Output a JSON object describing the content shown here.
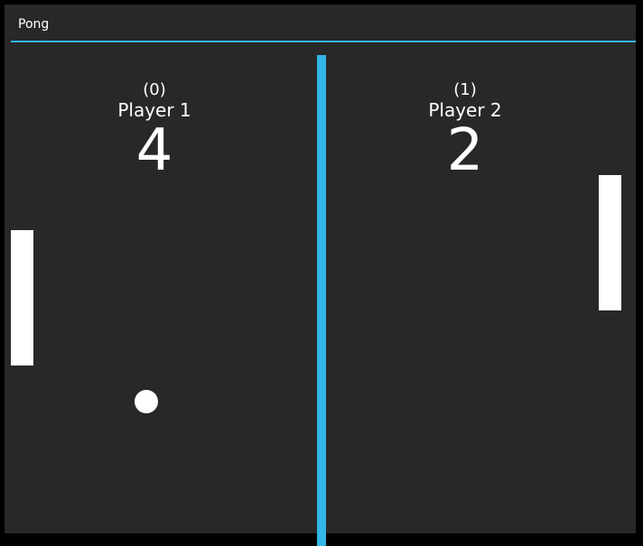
{
  "window": {
    "title": "Pong"
  },
  "players": [
    {
      "wins": "(0)",
      "name": "Player 1",
      "score": "4"
    },
    {
      "wins": "(1)",
      "name": "Player 2",
      "score": "2"
    }
  ],
  "colors": {
    "accent": "#33b5e5",
    "background": "#282828",
    "foreground": "#ffffff"
  }
}
